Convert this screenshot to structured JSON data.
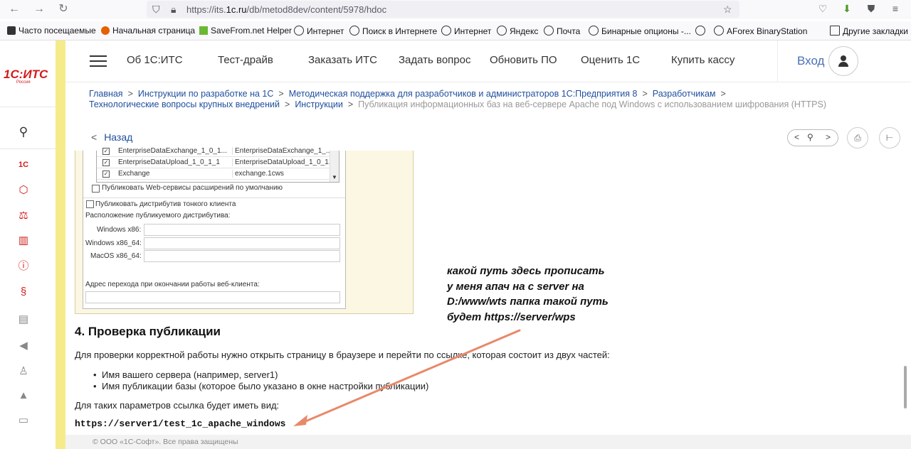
{
  "browser": {
    "url_prefix": "https://its.",
    "url_domain": "1c.ru",
    "url_rest": "/db/metod8dev/content/5978/hdoc",
    "bookmarks": [
      {
        "label": "Часто посещаемые"
      },
      {
        "label": "Начальная страница"
      },
      {
        "label": "SaveFrom.net Helper"
      },
      {
        "label": "Интернет"
      },
      {
        "label": "Поиск в Интернете"
      },
      {
        "label": "Интернет"
      },
      {
        "label": "Яндекс"
      },
      {
        "label": "Почта"
      },
      {
        "label": "Бинарные опционы -..."
      },
      {
        "label": ""
      },
      {
        "label": "AForex BinaryStation"
      },
      {
        "label": "Другие закладки"
      }
    ]
  },
  "logo": {
    "text": "1С:ИТС",
    "subtitle": "Россия"
  },
  "header": {
    "nav": [
      "Об 1С:ИТС",
      "Тест-драйв",
      "Заказать ИТС",
      "Задать вопрос",
      "Обновить ПО",
      "Оценить 1С",
      "Купить кассу"
    ],
    "login": "Вход"
  },
  "breadcrumbs": {
    "line1": [
      "Главная",
      "Инструкции по разработке на 1С",
      "Методическая поддержка для разработчиков и администраторов 1С:Предприятия 8",
      "Разработчикам"
    ],
    "line2": [
      "Технологические вопросы крупных внедрений",
      "Инструкции"
    ],
    "current": "Публикация информационных баз на веб-сервере Apache под Windows с использованием шифрования (HTTPS)"
  },
  "back_label": "Назад",
  "dialog": {
    "rows": [
      {
        "name": "EnterpriseDataExchange_1_0_1...",
        "value": "EnterpriseDataExchange_1_..."
      },
      {
        "name": "EnterpriseDataUpload_1_0_1_1",
        "value": "EnterpriseDataUpload_1_0_1..."
      },
      {
        "name": "Exchange",
        "value": "exchange.1cws"
      }
    ],
    "publish_ext_ws": "Публиковать Web-сервисы расширений по умолчанию",
    "publish_thin": "Публиковать дистрибутив тонкого клиента",
    "location_label": "Расположение публикуемого дистрибутива:",
    "win86": "Windows x86:",
    "win64": "Windows x86_64:",
    "mac": "MacOS x86_64:",
    "redirect_label": "Адрес перехода при окончании работы веб-клиента:"
  },
  "content": {
    "heading": "4. Проверка публикации",
    "para1": "Для проверки корректной работы нужно открыть страницу в браузере и перейти по ссылке, которая состоит из двух частей:",
    "items": [
      "Имя вашего сервера (например, server1)",
      "Имя публикации базы (которое было указано в окне настройки публикации)"
    ],
    "para2": "Для таких параметров ссылка будет иметь вид:",
    "example_url": "https://server1/test_1c_apache_windows"
  },
  "annotation": {
    "lines": [
      "какой путь здесь прописать",
      "у меня апач на с server на",
      "D:/www/wts папка такой путь",
      "будет https://server/wps"
    ],
    "arrow_color": "#e8896a"
  },
  "footer": "© ООО «1С-Софт». Все права защищены"
}
